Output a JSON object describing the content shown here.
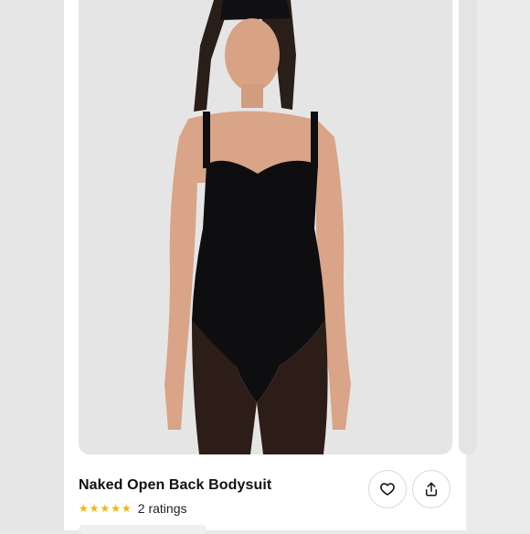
{
  "product": {
    "title": "Naked Open Back Bodysuit",
    "stars": "★★★★★",
    "rating_count": 2,
    "rating_label": "2 ratings"
  },
  "icons": {
    "favorite": "heart-icon",
    "share": "share-icon"
  },
  "colors": {
    "star": "#f2b705",
    "bodysuit": "#0e0e10"
  }
}
